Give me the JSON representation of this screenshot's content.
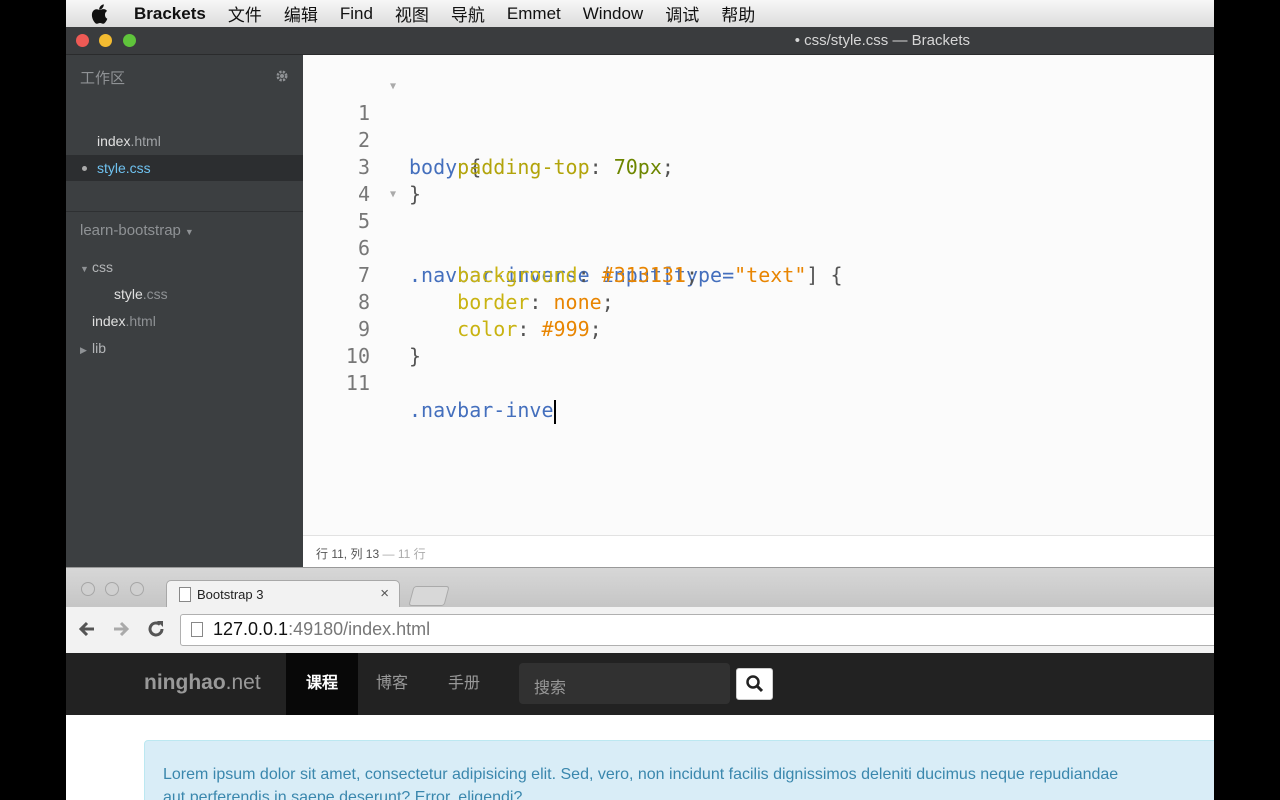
{
  "menubar": {
    "app": "Brackets",
    "items": [
      "文件",
      "编辑",
      "Find",
      "视图",
      "导航",
      "Emmet",
      "Window",
      "调试",
      "帮助"
    ]
  },
  "brackets": {
    "window_title": "• css/style.css — Brackets",
    "working_files_header": "工作区",
    "working_files": [
      {
        "base": "index",
        "ext": ".html"
      },
      {
        "base": "style",
        "ext": ".css"
      }
    ],
    "project_name": "learn-bootstrap",
    "tree": {
      "css_folder": "css",
      "css_file_base": "style",
      "css_file_ext": ".css",
      "index_base": "index",
      "index_ext": ".html",
      "lib_folder": "lib"
    },
    "line_numbers": [
      "1",
      "2",
      "3",
      "4",
      "5",
      "6",
      "7",
      "8",
      "9",
      "10",
      "11"
    ],
    "code": {
      "l1_sel": "body",
      "l1_brace": " {",
      "l2_prop": "padding-top",
      "l2_colon": ": ",
      "l2_val": "70px",
      "l2_semi": ";",
      "l3": "}",
      "l5_sel": ".navbar-inverse input",
      "l5_attr_open": "[type=",
      "l5_str": "\"text\"",
      "l5_close": "] {",
      "l6_prop": "background",
      "l6_val": "#313131",
      "l7_prop": "border",
      "l7_val": "none",
      "l8_prop": "color",
      "l8_val": "#999",
      "colon": ": ",
      "semi": ";",
      "l9": "}",
      "l11": ".navbar-inve"
    },
    "status": {
      "position": "行 11, 列 13",
      "lines": " — 11 行"
    }
  },
  "browser": {
    "tab_title": "Bootstrap 3",
    "tab_close": "×",
    "url_host": "127.0.0.1",
    "url_rest": ":49180/index.html",
    "site": {
      "brand_name": "ninghao",
      "brand_tld": ".net",
      "nav": [
        "课程",
        "博客",
        "手册"
      ],
      "search_placeholder": "搜索"
    },
    "alert_line1": "Lorem ipsum dolor sit amet, consectetur adipisicing elit. Sed, vero, non incidunt facilis dignissimos deleniti ducimus neque repudiandae",
    "alert_line2": "aut perferendis in saepe deserunt? Error, eligendi?"
  },
  "colors": {
    "sidebar_bg": "#3c3f41",
    "selected_file": "#6fc2f0",
    "navbar_bg": "#222222",
    "alert_bg": "#d9edf7"
  },
  "icons": [
    "apple-icon",
    "gear-icon",
    "document-icon",
    "back-icon",
    "forward-icon",
    "reload-icon",
    "search-icon"
  ]
}
